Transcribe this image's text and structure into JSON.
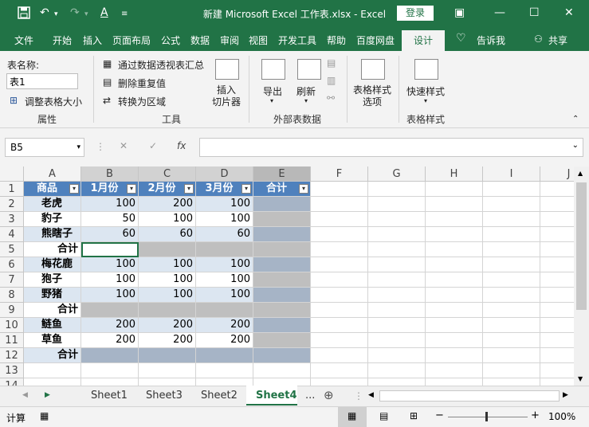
{
  "window": {
    "title": "新建 Microsoft Excel 工作表.xlsx  -  Excel",
    "login_label": "登录"
  },
  "ribbon_tabs": [
    "文件",
    "开始",
    "插入",
    "页面布局",
    "公式",
    "数据",
    "审阅",
    "视图",
    "开发工具",
    "帮助",
    "百度网盘",
    "设计"
  ],
  "tell_me": "告诉我",
  "share": "共享",
  "ribbon": {
    "table_name_label": "表名称:",
    "table_name_value": "表1",
    "resize_table": "调整表格大小",
    "properties_group": "属性",
    "summarize_pivot": "通过数据透视表汇总",
    "remove_duplicates": "删除重复值",
    "convert_to_range": "转换为区域",
    "tools_group": "工具",
    "insert_slicer": "插入\n切片器",
    "export": "导出",
    "refresh": "刷新",
    "external_group": "外部表数据",
    "style_options": "表格样式\n选项",
    "quick_styles": "快速样式",
    "styles_group": "表格样式"
  },
  "formula_bar": {
    "name_box": "B5",
    "cancel": "✕",
    "enter": "✓",
    "fx": "fx",
    "formula": ""
  },
  "columns": [
    "A",
    "B",
    "C",
    "D",
    "E",
    "F",
    "G",
    "H",
    "I",
    "J"
  ],
  "rows": [
    {
      "n": "1",
      "a": "商品",
      "b": "1月份",
      "c": "2月份",
      "d": "3月份",
      "e": "合计",
      "style": "header"
    },
    {
      "n": "2",
      "a": "老虎",
      "b": "100",
      "c": "200",
      "d": "100",
      "e": "",
      "style": "band"
    },
    {
      "n": "3",
      "a": "豹子",
      "b": "50",
      "c": "100",
      "d": "100",
      "e": "",
      "style": "plain"
    },
    {
      "n": "4",
      "a": "熊瞎子",
      "b": "60",
      "c": "60",
      "d": "60",
      "e": "",
      "style": "band"
    },
    {
      "n": "5",
      "a": "合计",
      "b": "",
      "c": "",
      "d": "",
      "e": "",
      "style": "subtotal"
    },
    {
      "n": "6",
      "a": "梅花鹿",
      "b": "100",
      "c": "100",
      "d": "100",
      "e": "",
      "style": "band"
    },
    {
      "n": "7",
      "a": "狍子",
      "b": "100",
      "c": "100",
      "d": "100",
      "e": "",
      "style": "plain"
    },
    {
      "n": "8",
      "a": "野猪",
      "b": "100",
      "c": "100",
      "d": "100",
      "e": "",
      "style": "band"
    },
    {
      "n": "9",
      "a": "合计",
      "b": "",
      "c": "",
      "d": "",
      "e": "",
      "style": "subtotal"
    },
    {
      "n": "10",
      "a": "鲢鱼",
      "b": "200",
      "c": "200",
      "d": "200",
      "e": "",
      "style": "band"
    },
    {
      "n": "11",
      "a": "草鱼",
      "b": "200",
      "c": "200",
      "d": "200",
      "e": "",
      "style": "plain"
    },
    {
      "n": "12",
      "a": "合计",
      "b": "",
      "c": "",
      "d": "",
      "e": "",
      "style": "total"
    },
    {
      "n": "13",
      "a": "",
      "b": "",
      "c": "",
      "d": "",
      "e": "",
      "style": "empty"
    },
    {
      "n": "14",
      "a": "",
      "b": "",
      "c": "",
      "d": "",
      "e": "",
      "style": "empty"
    }
  ],
  "sheets": [
    "Sheet1",
    "Sheet3",
    "Sheet2",
    "Sheet4"
  ],
  "active_sheet": "Sheet4",
  "sheet_more": "...",
  "status": {
    "mode": "计算",
    "zoom": "100%",
    "zoom_minus": "−",
    "zoom_plus": "+"
  },
  "colors": {
    "excel_green": "#217346",
    "header_blue": "#4f81bd",
    "band_blue": "#dce6f1"
  }
}
